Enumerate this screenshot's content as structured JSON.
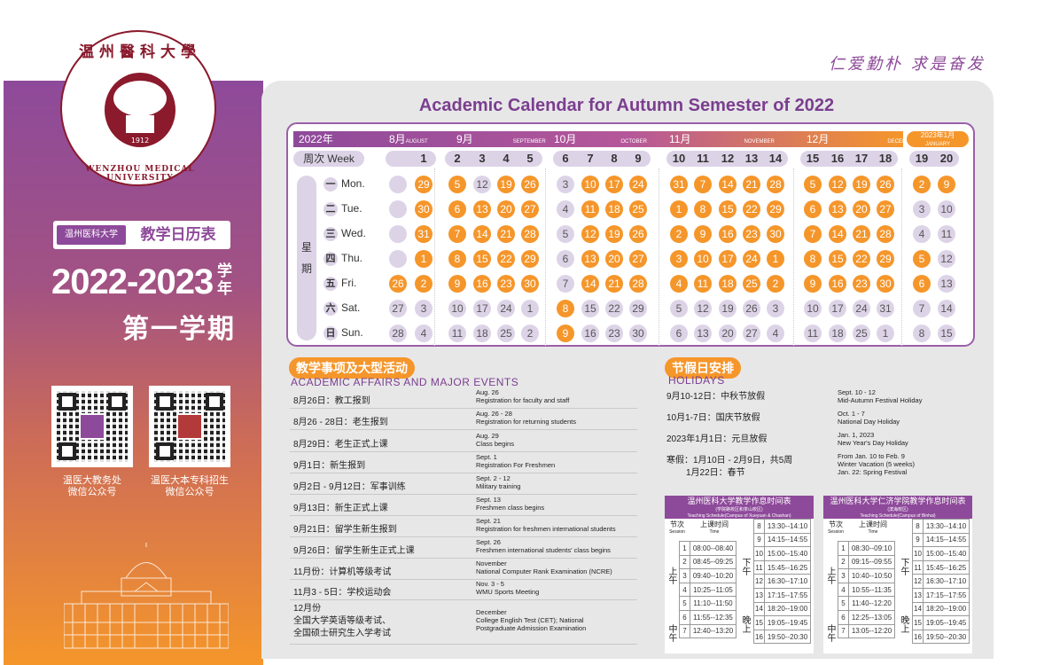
{
  "left": {
    "seal": {
      "cn": "温州醫科大學",
      "en": "WENZHOU MEDICAL UNIVERSITY",
      "year": "1912"
    },
    "badge_small": "温州医科大学",
    "badge_big": "教学日历表",
    "year_range": "2022-2023",
    "xue_nian": "学年",
    "term": "第一学期",
    "qr_captions": [
      [
        "温医大教务处",
        "微信公众号"
      ],
      [
        "温医大本专科招生",
        "微信公众号"
      ]
    ]
  },
  "motto": "仁爱勤朴  求是奋发",
  "title": "Academic Calendar for Autumn Semester of 2022",
  "calendar": {
    "year_label": "2022年",
    "week_header": "周次 Week",
    "week_vertical": [
      "星",
      "期"
    ],
    "months": [
      {
        "cn": "8月",
        "en": "AUGUST"
      },
      {
        "cn": "9月",
        "en": "SEPTEMBER"
      },
      {
        "cn": "10月",
        "en": "OCTOBER"
      },
      {
        "cn": "11月",
        "en": "NOVEMBER"
      },
      {
        "cn": "12月",
        "en": "DECEMBER"
      },
      {
        "cn": "2023年1月",
        "en": "JANUARY"
      }
    ],
    "day_labels": [
      {
        "cn": "一",
        "en": "Mon."
      },
      {
        "cn": "二",
        "en": "Tue."
      },
      {
        "cn": "三",
        "en": "Wed."
      },
      {
        "cn": "四",
        "en": "Thu."
      },
      {
        "cn": "五",
        "en": "Fri."
      },
      {
        "cn": "六",
        "en": "Sat."
      },
      {
        "cn": "日",
        "en": "Sun."
      }
    ],
    "weeks": [
      {
        "no": "",
        "days": [
          "",
          "",
          "",
          "",
          "26",
          "27",
          "28"
        ],
        "style": [
          "l",
          "l",
          "l",
          "l",
          "o",
          "g",
          "g"
        ]
      },
      {
        "no": "1",
        "days": [
          "29",
          "30",
          "31",
          "1",
          "2",
          "3",
          "4"
        ],
        "style": [
          "o",
          "o",
          "o",
          "o",
          "o",
          "g",
          "g"
        ]
      },
      {
        "no": "2",
        "days": [
          "5",
          "6",
          "7",
          "8",
          "9",
          "10",
          "11"
        ],
        "style": [
          "o",
          "o",
          "o",
          "o",
          "o",
          "g",
          "g"
        ]
      },
      {
        "no": "3",
        "days": [
          "12",
          "13",
          "14",
          "15",
          "16",
          "17",
          "18"
        ],
        "style": [
          "g",
          "o",
          "o",
          "o",
          "o",
          "g",
          "g"
        ]
      },
      {
        "no": "4",
        "days": [
          "19",
          "20",
          "21",
          "22",
          "23",
          "24",
          "25"
        ],
        "style": [
          "o",
          "o",
          "o",
          "o",
          "o",
          "g",
          "g"
        ]
      },
      {
        "no": "5",
        "days": [
          "26",
          "27",
          "28",
          "29",
          "30",
          "1",
          "2"
        ],
        "style": [
          "o",
          "o",
          "o",
          "o",
          "o",
          "g",
          "g"
        ]
      },
      {
        "no": "6",
        "days": [
          "3",
          "4",
          "5",
          "6",
          "7",
          "8",
          "9"
        ],
        "style": [
          "g",
          "g",
          "g",
          "g",
          "g",
          "o",
          "o"
        ]
      },
      {
        "no": "7",
        "days": [
          "10",
          "11",
          "12",
          "13",
          "14",
          "15",
          "16"
        ],
        "style": [
          "o",
          "o",
          "o",
          "o",
          "o",
          "g",
          "g"
        ]
      },
      {
        "no": "8",
        "days": [
          "17",
          "18",
          "19",
          "20",
          "21",
          "22",
          "23"
        ],
        "style": [
          "o",
          "o",
          "o",
          "o",
          "o",
          "g",
          "g"
        ]
      },
      {
        "no": "9",
        "days": [
          "24",
          "25",
          "26",
          "27",
          "28",
          "29",
          "30"
        ],
        "style": [
          "o",
          "o",
          "o",
          "o",
          "o",
          "g",
          "g"
        ]
      },
      {
        "no": "10",
        "days": [
          "31",
          "1",
          "2",
          "3",
          "4",
          "5",
          "6"
        ],
        "style": [
          "o",
          "o",
          "o",
          "o",
          "o",
          "g",
          "g"
        ]
      },
      {
        "no": "11",
        "days": [
          "7",
          "8",
          "9",
          "10",
          "11",
          "12",
          "13"
        ],
        "style": [
          "o",
          "o",
          "o",
          "o",
          "o",
          "g",
          "g"
        ]
      },
      {
        "no": "12",
        "days": [
          "14",
          "15",
          "16",
          "17",
          "18",
          "19",
          "20"
        ],
        "style": [
          "o",
          "o",
          "o",
          "o",
          "o",
          "g",
          "g"
        ]
      },
      {
        "no": "13",
        "days": [
          "21",
          "22",
          "23",
          "24",
          "25",
          "26",
          "27"
        ],
        "style": [
          "o",
          "o",
          "o",
          "o",
          "o",
          "g",
          "g"
        ]
      },
      {
        "no": "14",
        "days": [
          "28",
          "29",
          "30",
          "1",
          "2",
          "3",
          "4"
        ],
        "style": [
          "o",
          "o",
          "o",
          "o",
          "o",
          "g",
          "g"
        ]
      },
      {
        "no": "15",
        "days": [
          "5",
          "6",
          "7",
          "8",
          "9",
          "10",
          "11"
        ],
        "style": [
          "o",
          "o",
          "o",
          "o",
          "o",
          "g",
          "g"
        ]
      },
      {
        "no": "16",
        "days": [
          "12",
          "13",
          "14",
          "15",
          "16",
          "17",
          "18"
        ],
        "style": [
          "o",
          "o",
          "o",
          "o",
          "o",
          "g",
          "g"
        ]
      },
      {
        "no": "17",
        "days": [
          "19",
          "20",
          "21",
          "22",
          "23",
          "24",
          "25"
        ],
        "style": [
          "o",
          "o",
          "o",
          "o",
          "o",
          "g",
          "g"
        ]
      },
      {
        "no": "18",
        "days": [
          "26",
          "27",
          "28",
          "29",
          "30",
          "31",
          "1"
        ],
        "style": [
          "o",
          "o",
          "o",
          "o",
          "o",
          "g",
          "g"
        ]
      },
      {
        "no": "19",
        "days": [
          "2",
          "3",
          "4",
          "5",
          "6",
          "7",
          "8"
        ],
        "style": [
          "o",
          "g",
          "g",
          "o",
          "o",
          "g",
          "g"
        ]
      },
      {
        "no": "20",
        "days": [
          "9",
          "10",
          "11",
          "12",
          "13",
          "14",
          "15"
        ],
        "style": [
          "o",
          "g",
          "g",
          "g",
          "g",
          "g",
          "g"
        ]
      }
    ]
  },
  "affairs": {
    "head_cn": "教学事项及大型活动",
    "head_en": "ACADEMIC AFFAIRS AND MAJOR EVENTS",
    "rows": [
      {
        "cn": "8月26日：教工报到",
        "en1": "Aug. 26",
        "en2": "Registration for faculty and staff"
      },
      {
        "cn": "8月26 - 28日：老生报到",
        "en1": "Aug. 26 - 28",
        "en2": "Registration for returning students"
      },
      {
        "cn": "8月29日：老生正式上课",
        "en1": "Aug. 29",
        "en2": "Class begins"
      },
      {
        "cn": "9月1日：新生报到",
        "en1": "Sept. 1",
        "en2": "Registration For Freshmen"
      },
      {
        "cn": "9月2日 - 9月12日：军事训练",
        "en1": "Sept. 2 - 12",
        "en2": "Military training"
      },
      {
        "cn": "9月13日：新生正式上课",
        "en1": "Sept. 13",
        "en2": "Freshmen class begins"
      },
      {
        "cn": "9月21日：留学生新生报到",
        "en1": "Sept. 21",
        "en2": "Registration for freshmen international students"
      },
      {
        "cn": "9月26日：留学生新生正式上课",
        "en1": "Sept. 26",
        "en2": "Freshmen international students' class begins"
      },
      {
        "cn": "11月份：计算机等级考试",
        "en1": "November",
        "en2": "National Computer Rank Examination (NCRE)"
      },
      {
        "cn": "11月3 - 5日：学校运动会",
        "en1": "Nov. 3 - 5",
        "en2": "WMU Sports Meeting"
      },
      {
        "cn": "12月份",
        "cn2": "全国大学英语等级考试、",
        "cn3": "全国硕士研究生入学考试",
        "en1": "December",
        "en2": "College English Test (CET); National",
        "en3": "Postgraduate Admission Examination"
      }
    ]
  },
  "holidays": {
    "head_cn": "节假日安排",
    "head_en": "HOLIDAYS",
    "rows": [
      {
        "cn": "9月10-12日：中秋节放假",
        "en1": "Sept. 10 - 12",
        "en2": "Mid-Autumn Festival Holiday"
      },
      {
        "cn": "10月1-7日：国庆节放假",
        "en1": "Oct. 1 - 7",
        "en2": "National Day Holiday"
      },
      {
        "cn": "2023年1月1日：元旦放假",
        "en1": "Jan. 1, 2023",
        "en2": "New Year's Day Holiday"
      },
      {
        "cn": "寒假：1月10日 - 2月9日，共5周",
        "cn2": "1月22日：春节",
        "en1": "From Jan. 10 to Feb. 9",
        "en2": "Winter Vacation (5 weeks)",
        "en3": "Jan. 22: Spring Festival"
      }
    ]
  },
  "timetables": [
    {
      "title": "温州医科大学教学作息时间表",
      "subtitle": "(学院路校区和茶山校区)",
      "subtitle_en": "Teaching Schedule(Campus of Xueyuan & Chashan)",
      "session_head": "节次",
      "session_head_en": "Session",
      "time_head": "上课时间",
      "time_head_en": "Time",
      "rows": [
        "08:00--08:40",
        "08:45--09:25",
        "09:40--10:20",
        "10:25--11:05",
        "11:10--11:50",
        "11:55--12:35",
        "12:40--13:20",
        "13:30--14:10",
        "14:15--14:55",
        "15:00--15:40",
        "15:45--16:25",
        "16:30--17:10",
        "17:15--17:55",
        "18:20--19:00",
        "19:05--19:45",
        "19:50--20:30"
      ]
    },
    {
      "title": "温州医科大学仁济学院教学作息时间表",
      "subtitle": "(滨海校区)",
      "subtitle_en": "Teaching Schedule(Campus of Binhai)",
      "session_head": "节次",
      "session_head_en": "Session",
      "time_head": "上课时间",
      "time_head_en": "Time",
      "rows": [
        "08:30--09:10",
        "09:15--09:55",
        "10:40--10:50",
        "10:55--11:35",
        "11:40--12:20",
        "12:25--13:05",
        "13:05--12:20",
        "13:30--14:10",
        "14:15--14:55",
        "15:00--15:40",
        "15:45--16:25",
        "16:30--17:10",
        "17:15--17:55",
        "18:20--19:00",
        "19:05--19:45",
        "19:50--20:30"
      ]
    }
  ],
  "periods": {
    "am": "上午",
    "noon": "中午",
    "pm": "下午",
    "eve": "晚上"
  }
}
